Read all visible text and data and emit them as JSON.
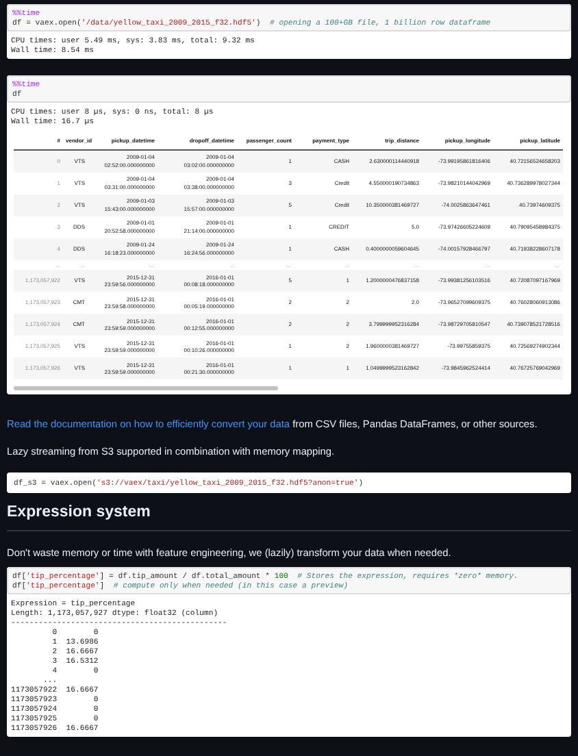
{
  "blocks": [
    {
      "kind": "cell",
      "input": [
        [
          {
            "text": "%%time",
            "kind": "magic"
          }
        ],
        [
          {
            "text": "df = vaex.open(",
            "kind": "plain"
          },
          {
            "text": "'/data/yellow_taxi_2009_2015_f32.hdf5'",
            "kind": "string"
          },
          {
            "text": ")  ",
            "kind": "plain"
          },
          {
            "text": "# opening a 100+GB file, 1 billion row dataframe",
            "kind": "comment"
          }
        ]
      ],
      "output": {
        "kind": "text",
        "lines": [
          "CPU times: user 5.49 ms, sys: 3.83 ms, total: 9.32 ms",
          "Wall time: 8.54 ms"
        ]
      }
    },
    {
      "kind": "cell",
      "input": [
        [
          {
            "text": "%%time",
            "kind": "magic"
          }
        ],
        [
          {
            "text": "df",
            "kind": "plain"
          }
        ]
      ],
      "output": {
        "kind": "table",
        "lines": [
          "CPU times: user 8 µs, sys: 0 ns, total: 8 µs",
          "Wall time: 16.7 µs"
        ],
        "columns": [
          "#",
          "vendor_id",
          "pickup_datetime",
          "dropoff_datetime",
          "passenger_count",
          "payment_type",
          "trip_distance",
          "pickup_longitude",
          "pickup_latitude"
        ],
        "rows": [
          {
            "kind": "data",
            "cells": [
              "0",
              "VTS",
              "2009-01-04 02:52:00.000000000",
              "2009-01-04 03:02:00.000000000",
              "1",
              "CASH",
              "2.630000114440918",
              "-73.99195861816406",
              "40.72156524658203"
            ]
          },
          {
            "kind": "data",
            "cells": [
              "1",
              "VTS",
              "2009-01-04 03:31:00.000000000",
              "2009-01-04 03:38:00.000000000",
              "3",
              "Credit",
              "4.550000190734863",
              "-73.98210144042969",
              "40.736289978027344"
            ]
          },
          {
            "kind": "data",
            "cells": [
              "2",
              "VTS",
              "2009-01-03 15:43:00.000000000",
              "2009-01-03 15:57:00.000000000",
              "5",
              "Credit",
              "10.350000381469727",
              "-74.0025863647461",
              "40.73974609375"
            ]
          },
          {
            "kind": "data",
            "cells": [
              "3",
              "DDS",
              "2009-01-01 20:52:58.000000000",
              "2009-01-01 21:14:00.000000000",
              "1",
              "CREDIT",
              "5.0",
              "-73.97426605224609",
              "40.79095458984375"
            ]
          },
          {
            "kind": "data",
            "cells": [
              "4",
              "DDS",
              "2009-01-24 16:18:23.000000000",
              "2009-01-24 16:24:56.000000000",
              "1",
              "CASH",
              "0.4000000059604645",
              "-74.00157928466797",
              "40.71938228607178"
            ]
          },
          {
            "kind": "ellipsis",
            "cells": [
              "...",
              "...",
              "...",
              "...",
              "...",
              "...",
              "...",
              "...",
              "..."
            ]
          },
          {
            "kind": "data",
            "cells": [
              "1,173,057,922",
              "VTS",
              "2015-12-31 23:59:56.000000000",
              "2016-01-01 00:08:18.000000000",
              "5",
              "1",
              "1.2000000476837158",
              "-73.99381256103516",
              "40.72087097167969"
            ]
          },
          {
            "kind": "data",
            "cells": [
              "1,173,057,923",
              "CMT",
              "2015-12-31 23:59:58.000000000",
              "2016-01-01 00:05:19.000000000",
              "2",
              "2",
              "2.0",
              "-73.96527099609375",
              "40.76028060913086"
            ]
          },
          {
            "kind": "data",
            "cells": [
              "1,173,057,924",
              "CMT",
              "2015-12-31 23:59:59.000000000",
              "2016-01-01 00:12:55.000000000",
              "2",
              "2",
              "3.799999952316284",
              "-73.98729705810547",
              "40.739078521728516"
            ]
          },
          {
            "kind": "data",
            "cells": [
              "1,173,057,925",
              "VTS",
              "2015-12-31 23:59:59.000000000",
              "2016-01-01 00:10:26.000000000",
              "1",
              "2",
              "1.9600000381469727",
              "-73.99755859375",
              "40.72569274902344"
            ]
          },
          {
            "kind": "data",
            "cells": [
              "1,173,057,926",
              "VTS",
              "2015-12-31 23:59:59.000000000",
              "2016-01-01 00:21:30.000000000",
              "1",
              "1",
              "1.0499999523162842",
              "-73.9845962524414",
              "40.76725769042969"
            ]
          }
        ]
      }
    },
    {
      "kind": "paragraph",
      "parts": [
        {
          "text": "Read the documentation on how to efficiently convert your data",
          "link": true
        },
        {
          "text": " from CSV files, Pandas DataFrames, or other sources.",
          "link": false
        }
      ]
    },
    {
      "kind": "paragraph",
      "parts": [
        {
          "text": "Lazy streaming from S3 supported in combination with memory mapping.",
          "link": false
        }
      ]
    },
    {
      "kind": "code",
      "input": [
        [
          {
            "text": "df_s3 = vaex.open(",
            "kind": "plain"
          },
          {
            "text": "'s3://vaex/taxi/yellow_taxi_2009_2015_f32.hdf5?anon=true'",
            "kind": "string"
          },
          {
            "text": ")",
            "kind": "plain"
          }
        ]
      ]
    },
    {
      "kind": "heading",
      "text": "Expression system"
    },
    {
      "kind": "paragraph",
      "parts": [
        {
          "text": "Don't waste memory or time with feature engineering, we (lazily) transform your data when needed.",
          "link": false
        }
      ]
    },
    {
      "kind": "cell",
      "input": [
        [
          {
            "text": "df[",
            "kind": "plain"
          },
          {
            "text": "'tip_percentage'",
            "kind": "string"
          },
          {
            "text": "] = df.tip_amount / df.total_amount * ",
            "kind": "plain"
          },
          {
            "text": "100",
            "kind": "number"
          },
          {
            "text": "  # Stores the expression, requires *zero* memory.",
            "kind": "comment"
          }
        ],
        [
          {
            "text": "df[",
            "kind": "plain"
          },
          {
            "text": "'tip_percentage'",
            "kind": "string"
          },
          {
            "text": "]  ",
            "kind": "plain"
          },
          {
            "text": "# compute only when needed (in this case a preview)",
            "kind": "comment"
          }
        ]
      ],
      "output": {
        "kind": "text",
        "lines": [
          "Expression = tip_percentage",
          "Length: 1,173,057,927 dtype: float32 (column)",
          "-----------------------------------------------",
          "         0        0",
          "         1  13.6986",
          "         2  16.6667",
          "         3  16.5312",
          "         4        0",
          "       ...",
          "1173057922  16.6667",
          "1173057923        0",
          "1173057924        0",
          "1173057925        0",
          "1173057926  16.6667"
        ]
      }
    }
  ]
}
